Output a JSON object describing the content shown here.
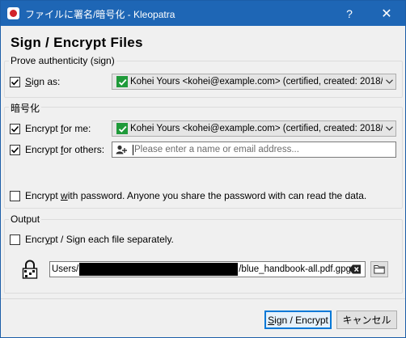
{
  "window": {
    "title": "ファイルに署名/暗号化 - Kleopatra",
    "help_glyph": "?",
    "close_glyph": "✕"
  },
  "page_title": "Sign / Encrypt Files",
  "sign_group": {
    "legend": "Prove authenticity (sign)",
    "sign_as": {
      "checked": true,
      "label_pre": "",
      "label_mnemonic": "S",
      "label_post": "ign as:",
      "value": "Kohei Yours <kohei@example.com> (certified,  created: 2018/"
    }
  },
  "encrypt_group": {
    "legend": "暗号化",
    "encrypt_for_me": {
      "checked": true,
      "label_pre": "Encrypt ",
      "label_mnemonic": "f",
      "label_post": "or me:",
      "value": "Kohei Yours <kohei@example.com> (certified,  created: 2018/"
    },
    "encrypt_for_others": {
      "checked": true,
      "label_pre": "Encrypt ",
      "label_mnemonic": "f",
      "label_post": "or others:",
      "placeholder": "Please enter a name or email address..."
    },
    "encrypt_with_password": {
      "checked": false,
      "label_pre": "Encrypt ",
      "label_mnemonic": "w",
      "label_post": "ith password. Anyone you share the password with can read the data."
    }
  },
  "output_group": {
    "legend": "Output",
    "separately": {
      "checked": false,
      "label_pre": "Encr",
      "label_mnemonic": "y",
      "label_post": "pt / Sign each file separately."
    },
    "path_prefix": "Users/",
    "path_suffix": "/blue_handbook-all.pdf.gpg"
  },
  "buttons": {
    "sign_encrypt_pre": "",
    "sign_encrypt_mnemonic": "S",
    "sign_encrypt_post": "ign / Encrypt",
    "cancel": "キャンセル"
  },
  "colors": {
    "titlebar": "#1e66b5",
    "badge_green": "#1f9a3a",
    "primary_border": "#0078d7"
  },
  "icons": {
    "app": "kleopatra-icon",
    "combo_badge": "certified-check-icon",
    "recipient": "add-recipient-icon",
    "output": "encrypted-file-icon",
    "clear": "clear-text-icon",
    "browse": "folder-icon"
  }
}
